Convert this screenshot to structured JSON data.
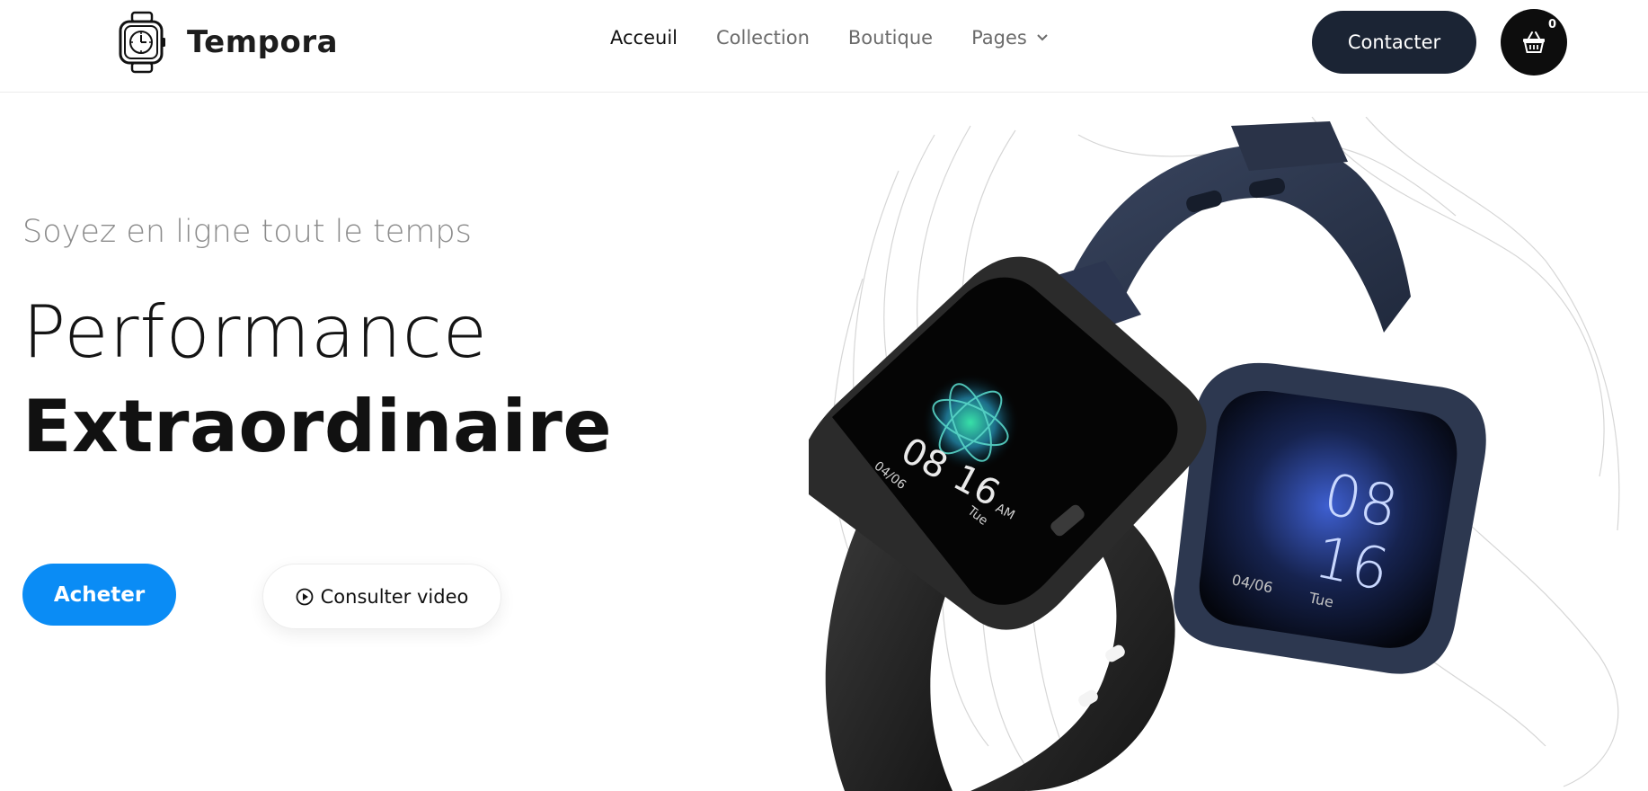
{
  "brand": {
    "name": "Tempora",
    "icon": "watch-icon"
  },
  "nav": {
    "items": [
      {
        "label": "Acceuil",
        "active": true
      },
      {
        "label": "Collection",
        "active": false
      },
      {
        "label": "Boutique",
        "active": false
      },
      {
        "label": "Pages",
        "active": false,
        "has_dropdown": true
      }
    ]
  },
  "header": {
    "contact_label": "Contacter",
    "cart": {
      "icon": "basket-icon",
      "count": "0"
    }
  },
  "hero": {
    "tagline": "Soyez en ligne tout le temps",
    "title_line1": "Performance",
    "title_line2": "Extraordinaire",
    "buy_label": "Acheter",
    "video_label": "Consulter video",
    "video_icon": "play-circle-icon",
    "watch_black": {
      "time_hours": "08",
      "time_minutes": "16",
      "ampm": "AM",
      "date": "04/06",
      "day": "Tue"
    },
    "watch_blue": {
      "time_hours": "08",
      "time_minutes": "16",
      "date": "04/06",
      "day": "Tue"
    }
  },
  "colors": {
    "primary_blue": "#0a8cf5",
    "contact_button": "#1b2434",
    "cart_button": "#0d0d0d",
    "watch_blue_strap": "#2d3850",
    "watch_black_strap": "#1e1e1e"
  }
}
